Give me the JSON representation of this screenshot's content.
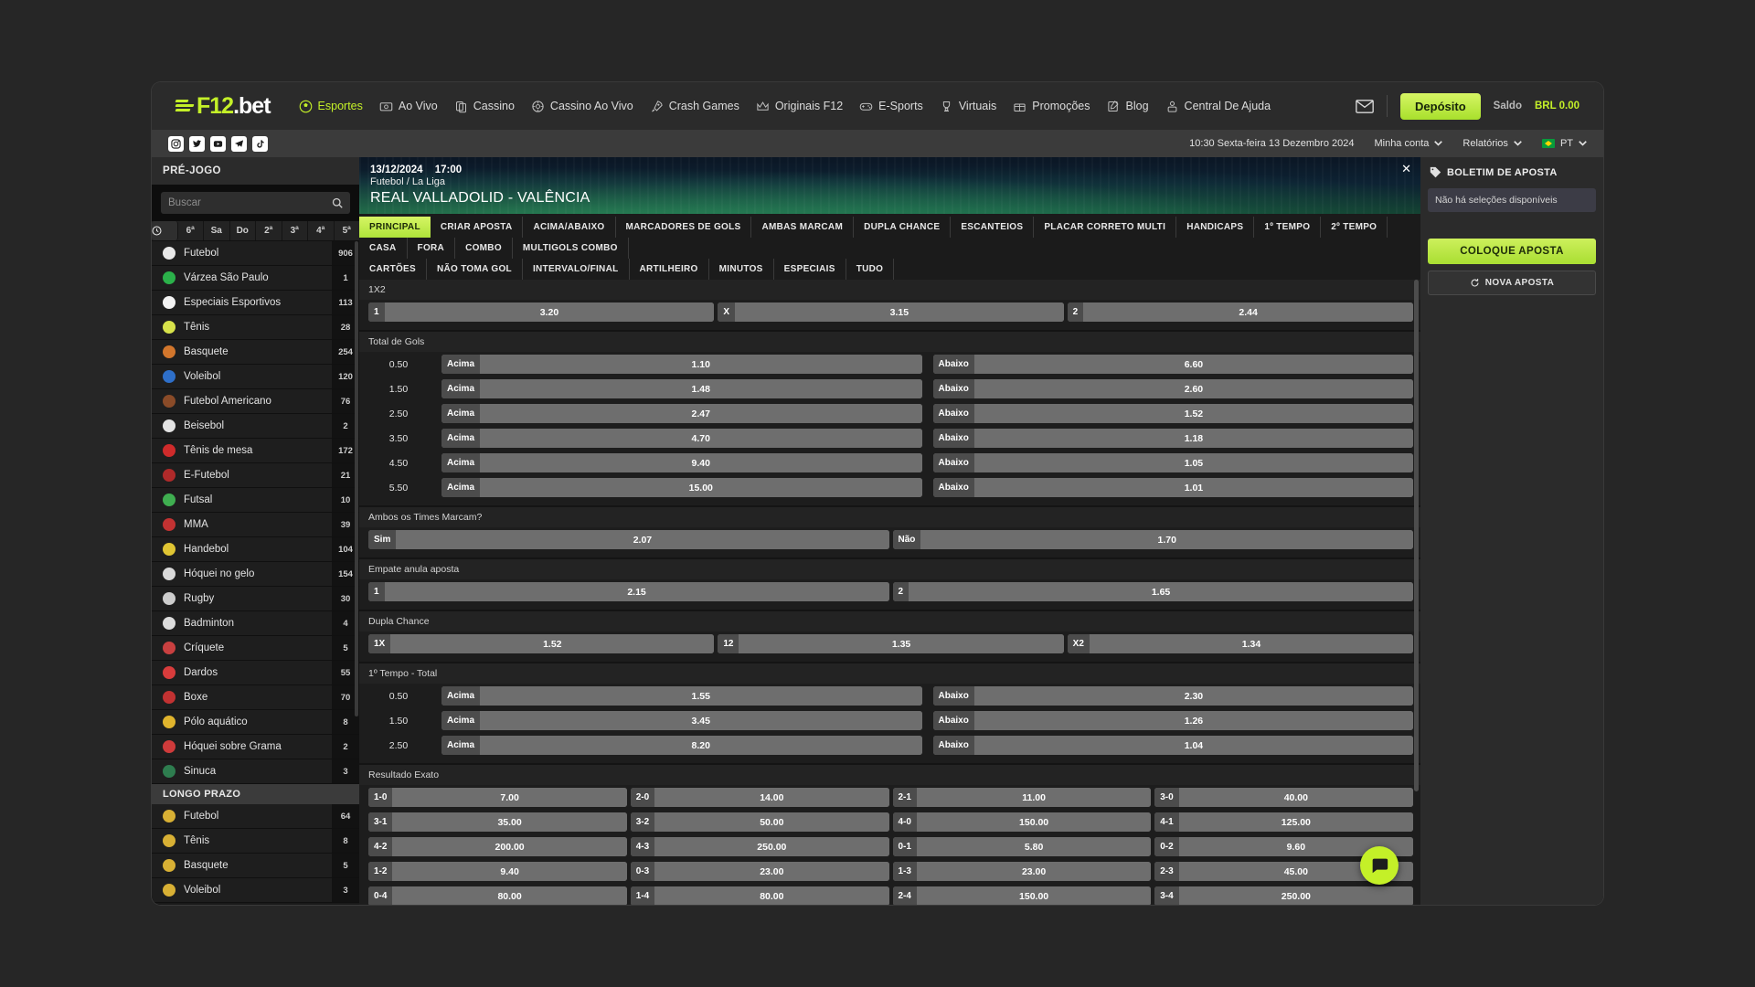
{
  "header": {
    "brand": {
      "a": "F12",
      "b": ".bet"
    },
    "nav": [
      {
        "label": "Esportes",
        "icon": "soccer-ball-icon",
        "active": true
      },
      {
        "label": "Ao Vivo",
        "icon": "live-tv-icon",
        "active": false
      },
      {
        "label": "Cassino",
        "icon": "cards-icon",
        "active": false
      },
      {
        "label": "Cassino Ao Vivo",
        "icon": "roulette-icon",
        "active": false
      },
      {
        "label": "Crash Games",
        "icon": "rocket-icon",
        "active": false
      },
      {
        "label": "Originais F12",
        "icon": "crown-icon",
        "active": false
      },
      {
        "label": "E-Sports",
        "icon": "gamepad-icon",
        "active": false
      },
      {
        "label": "Virtuais",
        "icon": "trophy-icon",
        "active": false
      },
      {
        "label": "Promoções",
        "icon": "gift-icon",
        "active": false
      },
      {
        "label": "Blog",
        "icon": "pencil-note-icon",
        "active": false
      },
      {
        "label": "Central De Ajuda",
        "icon": "support-person-icon",
        "active": false
      }
    ],
    "mail_icon": "envelope-icon",
    "deposit_label": "Depósito",
    "balance_label": "Saldo",
    "balance_value": "BRL 0.00",
    "accent": "#c4f028"
  },
  "subbar": {
    "social": [
      "instagram-icon",
      "twitter-icon",
      "youtube-icon",
      "telegram-icon",
      "tiktok-icon"
    ],
    "datetime": "10:30 Sexta-feira 13 Dezembro 2024",
    "account_label": "Minha conta",
    "reports_label": "Relatórios",
    "language": "PT"
  },
  "sidebar": {
    "title": "PRÉ-JOGO",
    "search_placeholder": "Buscar",
    "search_value": "",
    "search_icon": "magnifier-icon",
    "days": [
      "○",
      "6ª",
      "Sa",
      "Do",
      "2ª",
      "3ª",
      "4ª",
      "5ª"
    ],
    "sports": [
      {
        "label": "Futebol",
        "count": "906",
        "color": "#e8e8e8"
      },
      {
        "label": "Várzea São Paulo",
        "count": "1",
        "color": "#2bb14a"
      },
      {
        "label": "Especiais Esportivos",
        "count": "113",
        "color": "#f2f2f2"
      },
      {
        "label": "Tênis",
        "count": "28",
        "color": "#d7e24a"
      },
      {
        "label": "Basquete",
        "count": "254",
        "color": "#d2762c"
      },
      {
        "label": "Voleibol",
        "count": "120",
        "color": "#2e6fc9"
      },
      {
        "label": "Futebol Americano",
        "count": "76",
        "color": "#8a4b28"
      },
      {
        "label": "Beisebol",
        "count": "2",
        "color": "#e3e3e3"
      },
      {
        "label": "Tênis de mesa",
        "count": "172",
        "color": "#cf2b2b"
      },
      {
        "label": "E-Futebol",
        "count": "21",
        "color": "#b02a2a"
      },
      {
        "label": "Futsal",
        "count": "10",
        "color": "#3fae50"
      },
      {
        "label": "MMA",
        "count": "39",
        "color": "#c23232"
      },
      {
        "label": "Handebol",
        "count": "104",
        "color": "#e0c533"
      },
      {
        "label": "Hóquei no gelo",
        "count": "154",
        "color": "#d9d9d9"
      },
      {
        "label": "Rugby",
        "count": "30",
        "color": "#cdcdcd"
      },
      {
        "label": "Badminton",
        "count": "4",
        "color": "#dcdcdc"
      },
      {
        "label": "Críquete",
        "count": "5",
        "color": "#c94040"
      },
      {
        "label": "Dardos",
        "count": "55",
        "color": "#d83c3c"
      },
      {
        "label": "Boxe",
        "count": "70",
        "color": "#c23232"
      },
      {
        "label": "Pólo aquático",
        "count": "8",
        "color": "#e0b42d"
      },
      {
        "label": "Hóquei sobre Grama",
        "count": "2",
        "color": "#cf3b3b"
      },
      {
        "label": "Sinuca",
        "count": "3",
        "color": "#2e7d4f"
      }
    ],
    "longterm_title": "LONGO PRAZO",
    "longterm": [
      {
        "label": "Futebol",
        "count": "64",
        "color": "#d8b034"
      },
      {
        "label": "Tênis",
        "count": "8",
        "color": "#d8b034"
      },
      {
        "label": "Basquete",
        "count": "5",
        "color": "#d8b034"
      },
      {
        "label": "Voleibol",
        "count": "3",
        "color": "#d8b034"
      }
    ]
  },
  "match": {
    "date": "13/12/2024",
    "time": "17:00",
    "league": "Futebol / La Liga",
    "title": "REAL VALLADOLID - VALÊNCIA",
    "close_icon": "close-icon"
  },
  "tabs_row1": [
    {
      "label": "PRINCIPAL",
      "active": true
    },
    {
      "label": "CRIAR APOSTA",
      "active": false
    },
    {
      "label": "ACIMA/ABAIXO",
      "active": false
    },
    {
      "label": "MARCADORES DE GOLS",
      "active": false
    },
    {
      "label": "AMBAS MARCAM",
      "active": false
    },
    {
      "label": "DUPLA CHANCE",
      "active": false
    },
    {
      "label": "ESCANTEIOS",
      "active": false
    },
    {
      "label": "PLACAR CORRETO MULTI",
      "active": false
    },
    {
      "label": "HANDICAPS",
      "active": false
    },
    {
      "label": "1º TEMPO",
      "active": false
    },
    {
      "label": "2º TEMPO",
      "active": false
    },
    {
      "label": "CASA",
      "active": false
    },
    {
      "label": "FORA",
      "active": false
    },
    {
      "label": "COMBO",
      "active": false
    },
    {
      "label": "MULTIGOLS COMBO",
      "active": false
    }
  ],
  "tabs_row2": [
    {
      "label": "CARTÕES",
      "active": false
    },
    {
      "label": "NÃO TOMA GOL",
      "active": false
    },
    {
      "label": "INTERVALO/FINAL",
      "active": false
    },
    {
      "label": "ARTILHEIRO",
      "active": false
    },
    {
      "label": "MINUTOS",
      "active": false
    },
    {
      "label": "ESPECIAIS",
      "active": false
    },
    {
      "label": "TUDO",
      "active": false
    }
  ],
  "markets": [
    {
      "name": "1X2",
      "type": "row",
      "selections": [
        {
          "key": "1",
          "odd": "3.20"
        },
        {
          "key": "X",
          "odd": "3.15"
        },
        {
          "key": "2",
          "odd": "2.44"
        }
      ]
    },
    {
      "name": "Total de Gols",
      "type": "overunder",
      "over_label": "Acima",
      "under_label": "Abaixo",
      "lines": [
        {
          "line": "0.50",
          "over": "1.10",
          "under": "6.60"
        },
        {
          "line": "1.50",
          "over": "1.48",
          "under": "2.60"
        },
        {
          "line": "2.50",
          "over": "2.47",
          "under": "1.52"
        },
        {
          "line": "3.50",
          "over": "4.70",
          "under": "1.18"
        },
        {
          "line": "4.50",
          "over": "9.40",
          "under": "1.05"
        },
        {
          "line": "5.50",
          "over": "15.00",
          "under": "1.01"
        }
      ]
    },
    {
      "name": "Ambos os Times Marcam?",
      "type": "row",
      "selections": [
        {
          "key": "Sim",
          "odd": "2.07"
        },
        {
          "key": "Não",
          "odd": "1.70"
        }
      ]
    },
    {
      "name": "Empate anula aposta",
      "type": "row",
      "selections": [
        {
          "key": "1",
          "odd": "2.15"
        },
        {
          "key": "2",
          "odd": "1.65"
        }
      ]
    },
    {
      "name": "Dupla Chance",
      "type": "row",
      "selections": [
        {
          "key": "1X",
          "odd": "1.52"
        },
        {
          "key": "12",
          "odd": "1.35"
        },
        {
          "key": "X2",
          "odd": "1.34"
        }
      ]
    },
    {
      "name": "1º Tempo - Total",
      "type": "overunder",
      "over_label": "Acima",
      "under_label": "Abaixo",
      "lines": [
        {
          "line": "0.50",
          "over": "1.55",
          "under": "2.30"
        },
        {
          "line": "1.50",
          "over": "3.45",
          "under": "1.26"
        },
        {
          "line": "2.50",
          "over": "8.20",
          "under": "1.04"
        }
      ]
    },
    {
      "name": "Resultado Exato",
      "type": "grid",
      "selections": [
        {
          "key": "1-0",
          "odd": "7.00"
        },
        {
          "key": "2-0",
          "odd": "14.00"
        },
        {
          "key": "2-1",
          "odd": "11.00"
        },
        {
          "key": "3-0",
          "odd": "40.00"
        },
        {
          "key": "3-1",
          "odd": "35.00"
        },
        {
          "key": "3-2",
          "odd": "50.00"
        },
        {
          "key": "4-0",
          "odd": "150.00"
        },
        {
          "key": "4-1",
          "odd": "125.00"
        },
        {
          "key": "4-2",
          "odd": "200.00"
        },
        {
          "key": "4-3",
          "odd": "250.00"
        },
        {
          "key": "0-1",
          "odd": "5.80"
        },
        {
          "key": "0-2",
          "odd": "9.60"
        },
        {
          "key": "1-2",
          "odd": "9.40"
        },
        {
          "key": "0-3",
          "odd": "23.00"
        },
        {
          "key": "1-3",
          "odd": "23.00"
        },
        {
          "key": "2-3",
          "odd": "45.00"
        },
        {
          "key": "0-4",
          "odd": "80.00"
        },
        {
          "key": "1-4",
          "odd": "80.00"
        },
        {
          "key": "2-4",
          "odd": "150.00"
        },
        {
          "key": "3-4",
          "odd": "250.00"
        }
      ]
    }
  ],
  "betslip": {
    "title": "BOLETIM DE APOSTA",
    "tag_icon": "tag-icon",
    "empty_text": "Não há seleções disponíveis",
    "place_label": "COLOQUE APOSTA",
    "new_label": "NOVA APOSTA",
    "new_icon": "reload-icon"
  },
  "chat": {
    "icon": "chat-bubble-icon"
  }
}
